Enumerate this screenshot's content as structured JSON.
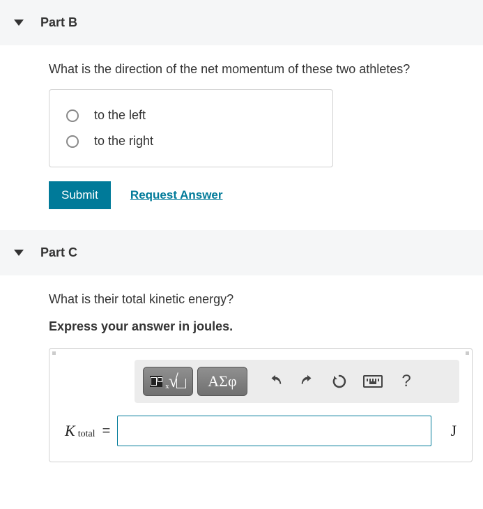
{
  "partB": {
    "title": "Part B",
    "question": "What is the direction of the net momentum of these two athletes?",
    "options": [
      "to the left",
      "to the right"
    ],
    "submit": "Submit",
    "request": "Request Answer"
  },
  "partC": {
    "title": "Part C",
    "question": "What is their total kinetic energy?",
    "instruction": "Express your answer in joules.",
    "greek": "ΑΣφ",
    "help": "?",
    "variable": "K",
    "subscript": "total",
    "equals": "=",
    "unit": "J"
  }
}
